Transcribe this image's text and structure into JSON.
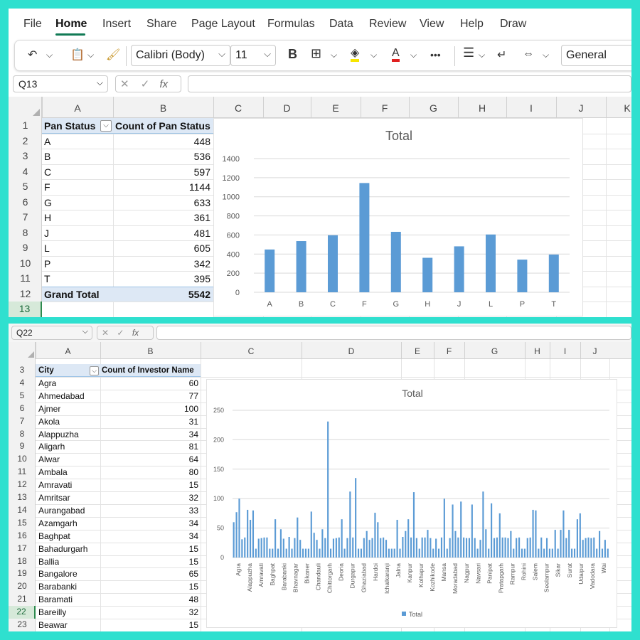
{
  "top": {
    "menu": [
      "File",
      "Home",
      "Insert",
      "Share",
      "Page Layout",
      "Formulas",
      "Data",
      "Review",
      "View",
      "Help",
      "Draw"
    ],
    "active_menu": "Home",
    "ribbon": {
      "font_name": "Calibri (Body)",
      "font_size": "11",
      "bold_label": "B",
      "number_format": "General",
      "more_label": "•••"
    },
    "name_box": "Q13",
    "columns": [
      "A",
      "B",
      "C",
      "D",
      "E",
      "F",
      "G",
      "H",
      "I",
      "J",
      "K"
    ],
    "rows": [
      "1",
      "2",
      "3",
      "4",
      "5",
      "6",
      "7",
      "8",
      "9",
      "10",
      "11",
      "12",
      "13"
    ],
    "pivot": {
      "header_status": "Pan Status",
      "header_count": "Count of Pan Status",
      "rows": [
        {
          "status": "A",
          "count": "448"
        },
        {
          "status": "B",
          "count": "536"
        },
        {
          "status": "C",
          "count": "597"
        },
        {
          "status": "F",
          "count": "1144"
        },
        {
          "status": "G",
          "count": "633"
        },
        {
          "status": "H",
          "count": "361"
        },
        {
          "status": "J",
          "count": "481"
        },
        {
          "status": "L",
          "count": "605"
        },
        {
          "status": "P",
          "count": "342"
        },
        {
          "status": "T",
          "count": "395"
        }
      ],
      "grand_total_label": "Grand Total",
      "grand_total": "5542"
    }
  },
  "bottom": {
    "name_box": "Q22",
    "columns": [
      "A",
      "B",
      "C",
      "D",
      "E",
      "F",
      "G",
      "H",
      "I",
      "J"
    ],
    "rows": [
      "3",
      "4",
      "5",
      "6",
      "7",
      "8",
      "9",
      "10",
      "11",
      "12",
      "13",
      "14",
      "15",
      "16",
      "17",
      "18",
      "19",
      "20",
      "21",
      "22",
      "23"
    ],
    "pivot": {
      "header_city": "City",
      "header_count": "Count of Investor Name",
      "rows": [
        {
          "city": "Agra",
          "count": "60"
        },
        {
          "city": "Ahmedabad",
          "count": "77"
        },
        {
          "city": "Ajmer",
          "count": "100"
        },
        {
          "city": "Akola",
          "count": "31"
        },
        {
          "city": "Alappuzha",
          "count": "34"
        },
        {
          "city": "Aligarh",
          "count": "81"
        },
        {
          "city": "Alwar",
          "count": "64"
        },
        {
          "city": "Ambala",
          "count": "80"
        },
        {
          "city": "Amravati",
          "count": "15"
        },
        {
          "city": "Amritsar",
          "count": "32"
        },
        {
          "city": "Aurangabad",
          "count": "33"
        },
        {
          "city": "Azamgarh",
          "count": "34"
        },
        {
          "city": "Baghpat",
          "count": "34"
        },
        {
          "city": "Bahadurgarh",
          "count": "15"
        },
        {
          "city": "Ballia",
          "count": "15"
        },
        {
          "city": "Bangalore",
          "count": "65"
        },
        {
          "city": "Barabanki",
          "count": "15"
        },
        {
          "city": "Baramati",
          "count": "48"
        },
        {
          "city": "Bareilly",
          "count": "32"
        },
        {
          "city": "Beawar",
          "count": "15"
        }
      ]
    }
  },
  "chart_data": [
    {
      "type": "bar",
      "title": "Total",
      "categories": [
        "A",
        "B",
        "C",
        "F",
        "G",
        "H",
        "J",
        "L",
        "P",
        "T"
      ],
      "values": [
        448,
        536,
        597,
        1144,
        633,
        361,
        481,
        605,
        342,
        395
      ],
      "ylim": [
        0,
        1400
      ],
      "yticks": [
        "0",
        "200",
        "400",
        "600",
        "800",
        "1000",
        "1200",
        "1400"
      ],
      "xlabel": "",
      "ylabel": "",
      "grid": true,
      "color": "#5b9bd5"
    },
    {
      "type": "bar",
      "title": "Total",
      "legend": "Total",
      "legend_position": "bottom",
      "ylim": [
        0,
        250
      ],
      "yticks": [
        "0",
        "50",
        "100",
        "150",
        "200",
        "250"
      ],
      "tick_labels": [
        "Agra",
        "Alappuzha",
        "Amravati",
        "Baghpat",
        "Barabanki",
        "Bhavnagar",
        "Bikaner",
        "Chandauli",
        "Chittorgarh",
        "Deoria",
        "Durgapur",
        "Ghaziabad",
        "Hardoi",
        "Ichalkaranji",
        "Jalna",
        "Kanpur",
        "Kolhapur",
        "Kozhikode",
        "Mansa",
        "Moradabad",
        "Nagpur",
        "Navsari",
        "Panipat",
        "Pratapgarh",
        "Rampur",
        "Rohini",
        "Salem",
        "Seelampur",
        "Sikar",
        "Surat",
        "Udaipur",
        "Vadodara",
        "Wai"
      ],
      "values": [
        60,
        77,
        100,
        31,
        34,
        81,
        64,
        80,
        15,
        32,
        33,
        34,
        34,
        15,
        15,
        65,
        15,
        48,
        32,
        15,
        35,
        15,
        33,
        68,
        30,
        15,
        15,
        15,
        78,
        42,
        30,
        15,
        48,
        33,
        231,
        15,
        32,
        33,
        34,
        65,
        15,
        33,
        112,
        34,
        135,
        15,
        15,
        33,
        45,
        30,
        33,
        76,
        60,
        33,
        34,
        30,
        15,
        15,
        15,
        64,
        15,
        35,
        45,
        65,
        34,
        111,
        33,
        15,
        34,
        34,
        47,
        33,
        15,
        32,
        15,
        34,
        100,
        15,
        33,
        90,
        45,
        34,
        95,
        34,
        33,
        33,
        90,
        33,
        15,
        30,
        112,
        48,
        15,
        92,
        33,
        34,
        75,
        34,
        34,
        33,
        45,
        15,
        33,
        34,
        15,
        15,
        33,
        34,
        81,
        80,
        15,
        34,
        15,
        33,
        15,
        15,
        47,
        15,
        47,
        80,
        33,
        47,
        15,
        15,
        65,
        75,
        30,
        33,
        34,
        33,
        34,
        15,
        45,
        15,
        30,
        15
      ],
      "xlabel": "",
      "ylabel": "",
      "grid": true,
      "color": "#5b9bd5"
    }
  ]
}
